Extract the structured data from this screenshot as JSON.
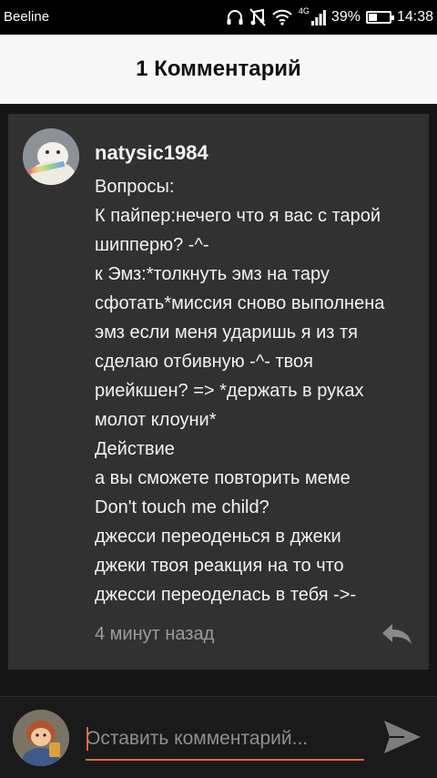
{
  "status_bar": {
    "carrier": "Beeline",
    "network_type": "4G",
    "battery_text": "39%",
    "battery_level": 0.39,
    "time": "14:38",
    "icons": [
      "headphones-icon",
      "mute-icon",
      "wifi-icon",
      "signal-icon",
      "battery-icon"
    ]
  },
  "header": {
    "title": "1 Комментарий"
  },
  "comment": {
    "username": "natysic1984",
    "lines": [
      "Вопросы:",
      "К пайпер:нечего что я вас с тарой",
      "шипперю? -^-",
      "к Эмз:*толкнуть эмз на тару",
      "сфотать*миссия сново выполнена",
      "эмз если меня ударишь я из тя",
      "сделаю отбивную -^- твоя",
      "риейкшен? => *держать в руках",
      "молот клоуни*",
      "Действие",
      "а вы сможете повторить меме",
      "Don't touch me child?",
      "джесси переоденься в джеки",
      "джеки твоя реакция на то что",
      "джесси переоделась в тебя ->-"
    ],
    "timestamp": "4 минут назад",
    "reply_icon": "reply-icon"
  },
  "input": {
    "placeholder": "Оставить комментарий...",
    "value": "",
    "send_icon": "send-icon"
  },
  "colors": {
    "accent": "#e06a3c",
    "card_bg": "#313131",
    "page_bg": "#151515",
    "header_bg": "#f7f7f7"
  }
}
